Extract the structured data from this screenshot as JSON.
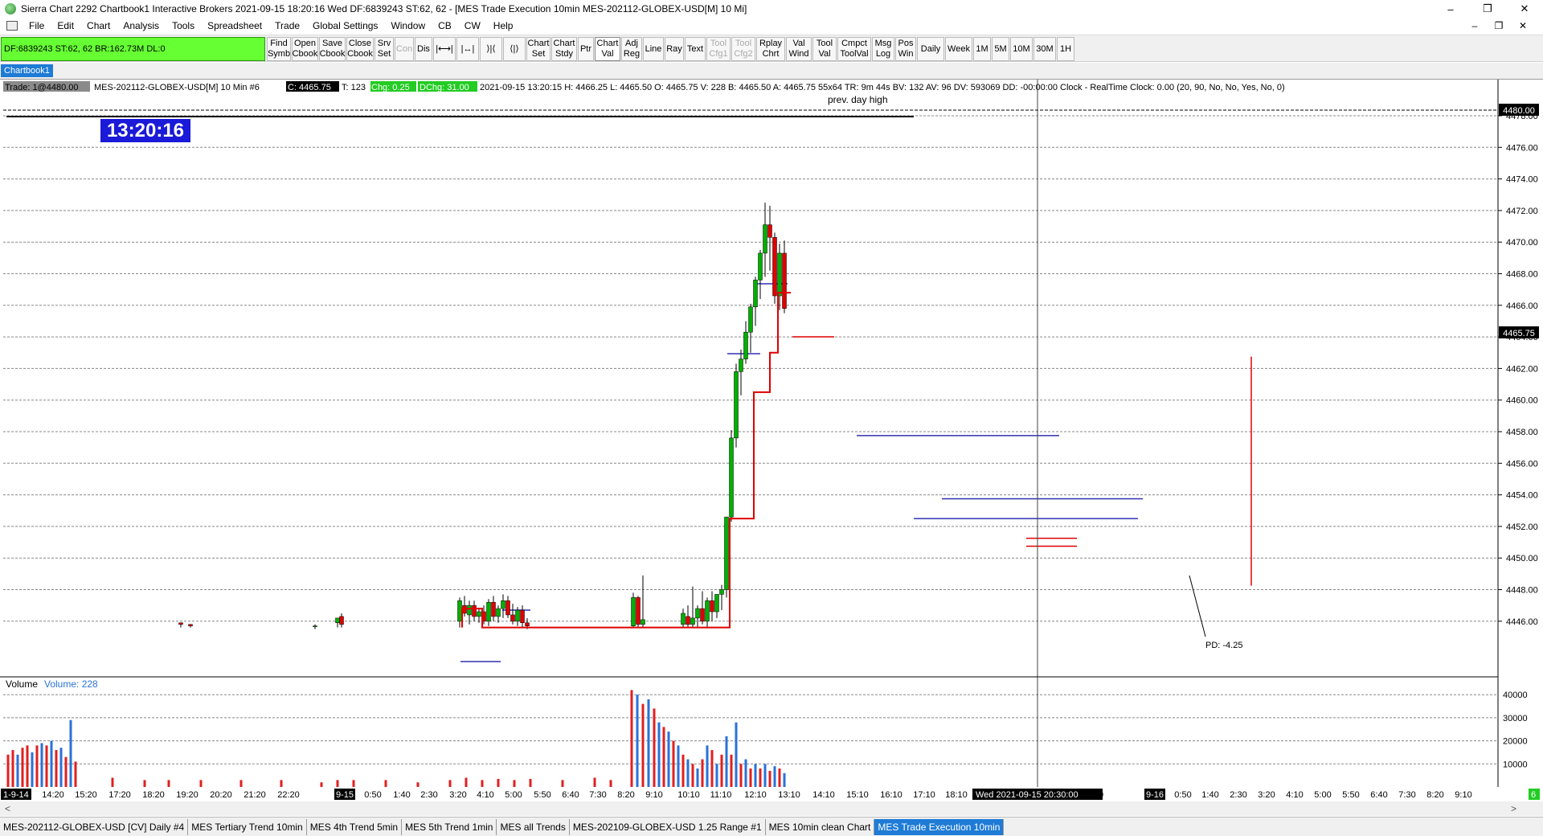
{
  "window": {
    "title": "Sierra Chart 2292 Chartbook1  Interactive Brokers 2021-09-15  18:20:16 Wed  DF:6839243  ST:62, 62 - [MES Trade Execution 10min MES-202112-GLOBEX-USD[M]  10 Mi]",
    "min_glyph": "–",
    "max_glyph": "❐",
    "close_glyph": "✕"
  },
  "menu": {
    "items": [
      "File",
      "Edit",
      "Chart",
      "Analysis",
      "Tools",
      "Spreadsheet",
      "Trade",
      "Global Settings",
      "Window",
      "CB",
      "CW",
      "Help"
    ],
    "mdi_min": "–",
    "mdi_restore": "❐",
    "mdi_close": "✕"
  },
  "toolbar": {
    "status_text": "DF:6839243  ST:62, 62  BR:162.73M  DL:0",
    "buttons": [
      {
        "label": "Find\nSymb",
        "w": 30,
        "state": "normal"
      },
      {
        "label": "Open\nCbook",
        "w": 33,
        "state": "normal"
      },
      {
        "label": "Save\nCbook",
        "w": 33,
        "state": "normal"
      },
      {
        "label": "Close\nCbook",
        "w": 34,
        "state": "normal"
      },
      {
        "label": "Srv\nSet",
        "w": 24,
        "state": "normal"
      },
      {
        "label": "Con",
        "w": 24,
        "state": "disabled"
      },
      {
        "label": "Dis",
        "w": 22,
        "state": "normal"
      },
      {
        "label": "|⟷|",
        "w": 28,
        "state": "normal"
      },
      {
        "label": "|↔|",
        "w": 28,
        "state": "normal"
      },
      {
        "label": "⟩|⟨",
        "w": 28,
        "state": "normal"
      },
      {
        "label": "⟨|⟩",
        "w": 28,
        "state": "normal"
      },
      {
        "label": "Chart\nSet",
        "w": 30,
        "state": "normal"
      },
      {
        "label": "Chart\nStdy",
        "w": 32,
        "state": "normal"
      },
      {
        "label": "Ptr",
        "w": 20,
        "state": "normal"
      },
      {
        "label": "Chart\nVal",
        "w": 32,
        "state": "active"
      },
      {
        "label": "Adj\nReg",
        "w": 26,
        "state": "normal"
      },
      {
        "label": "Line",
        "w": 26,
        "state": "normal"
      },
      {
        "label": "Ray",
        "w": 24,
        "state": "normal"
      },
      {
        "label": "Text",
        "w": 26,
        "state": "normal"
      },
      {
        "label": "Tool\nCfg1",
        "w": 30,
        "state": "disabled"
      },
      {
        "label": "Tool\nCfg2",
        "w": 30,
        "state": "disabled"
      },
      {
        "label": "Rplay\nChrt",
        "w": 36,
        "state": "normal"
      },
      {
        "label": "Val\nWind",
        "w": 32,
        "state": "normal"
      },
      {
        "label": "Tool\nVal",
        "w": 30,
        "state": "normal"
      },
      {
        "label": "Cmpct\nToolVal",
        "w": 42,
        "state": "normal"
      },
      {
        "label": "Msg\nLog",
        "w": 28,
        "state": "normal"
      },
      {
        "label": "Pos\nWin",
        "w": 26,
        "state": "normal"
      },
      {
        "label": "Daily",
        "w": 34,
        "state": "normal"
      },
      {
        "label": "Week",
        "w": 34,
        "state": "normal"
      },
      {
        "label": "1M",
        "w": 22,
        "state": "normal"
      },
      {
        "label": "5M",
        "w": 22,
        "state": "normal"
      },
      {
        "label": "10M",
        "w": 28,
        "state": "normal"
      },
      {
        "label": "30M",
        "w": 28,
        "state": "normal"
      },
      {
        "label": "1H",
        "w": 22,
        "state": "normal"
      }
    ]
  },
  "chartbook_tab": "Chartbook1",
  "chart": {
    "header": {
      "trade": "Trade: 1@4480.00",
      "symbol": "MES-202112-GLOBEX-USD[M]  10 Min  #6",
      "close": "C: 4465.75",
      "ticks": "T: 123",
      "chg": "Chg: 0.25",
      "dchg": "DChg: 31.00",
      "details": "2021-09-15 13:20:15 H: 4466.25 L: 4465.50 O: 4465.75 V: 228 B: 4465.50 A: 4465.75 55x64 TR: 9m 44s BV: 132 AV: 96 DV: 593069 DD: -00:00:00 Clock - RealTime  Clock: 0.00   (20, 90, No, No, Yes, No, 0)"
    },
    "clock_box": "13:20:16",
    "prev_day_high_label": "prev. day high",
    "pd_label": "PD: -4.25",
    "volume_header": "Volume",
    "volume_value": "Volume: 228",
    "price_axis_labels": [
      "4478.00",
      "4476.00",
      "4474.00",
      "4472.00",
      "4470.00",
      "4468.00",
      "4466.00",
      "4464.00",
      "4462.00",
      "4460.00",
      "4458.00",
      "4456.00",
      "4454.00",
      "4452.00",
      "4450.00",
      "4448.00",
      "4446.00"
    ],
    "price_top_label": "4480.00",
    "price_last_label": "4465.75",
    "volume_axis_labels": [
      "40000",
      "30000",
      "20000",
      "10000"
    ],
    "time_axis": {
      "start_box": "1-9-14",
      "day_box": "9-15",
      "cursor_box": "Wed 2021-09-15  20:30:00",
      "next_day_box": "9-16",
      "end_box": "6",
      "labels": [
        "14:20",
        "15:20",
        "17:20",
        "18:20",
        "19:20",
        "20:20",
        "21:20",
        "22:20",
        "0:50",
        "1:40",
        "2:30",
        "3:20",
        "4:10",
        "5:00",
        "5:50",
        "6:40",
        "7:30",
        "8:20",
        "9:10",
        "10:10",
        "11:10",
        "12:10",
        "13:10",
        "14:10",
        "15:10",
        "16:10",
        "17:10",
        "18:10",
        "0",
        "0:50",
        "1:40",
        "2:30",
        "3:20",
        "4:10",
        "5:00",
        "5:50",
        "6:40",
        "7:30",
        "8:20",
        "9:10"
      ]
    },
    "colors": {
      "up": "#00b000",
      "down": "#e00000",
      "vol_up": "#2a72d8",
      "vol_down": "#e02020",
      "navy_line": "#3030b0",
      "clock_bg": "#1a1ad8"
    }
  },
  "bottom_tabs": [
    {
      "label": "MES-202112-GLOBEX-USD [CV]  Daily  #4",
      "active": false
    },
    {
      "label": "MES Tertiary Trend 10min",
      "active": false
    },
    {
      "label": "MES 4th Trend 5min",
      "active": false
    },
    {
      "label": "MES 5th Trend 1min",
      "active": false
    },
    {
      "label": "MES all Trends",
      "active": false
    },
    {
      "label": "MES-202109-GLOBEX-USD  1.25 Range  #1",
      "active": false
    },
    {
      "label": "MES 10min clean Chart",
      "active": false
    },
    {
      "label": "MES Trade Execution 10min",
      "active": true
    }
  ]
}
